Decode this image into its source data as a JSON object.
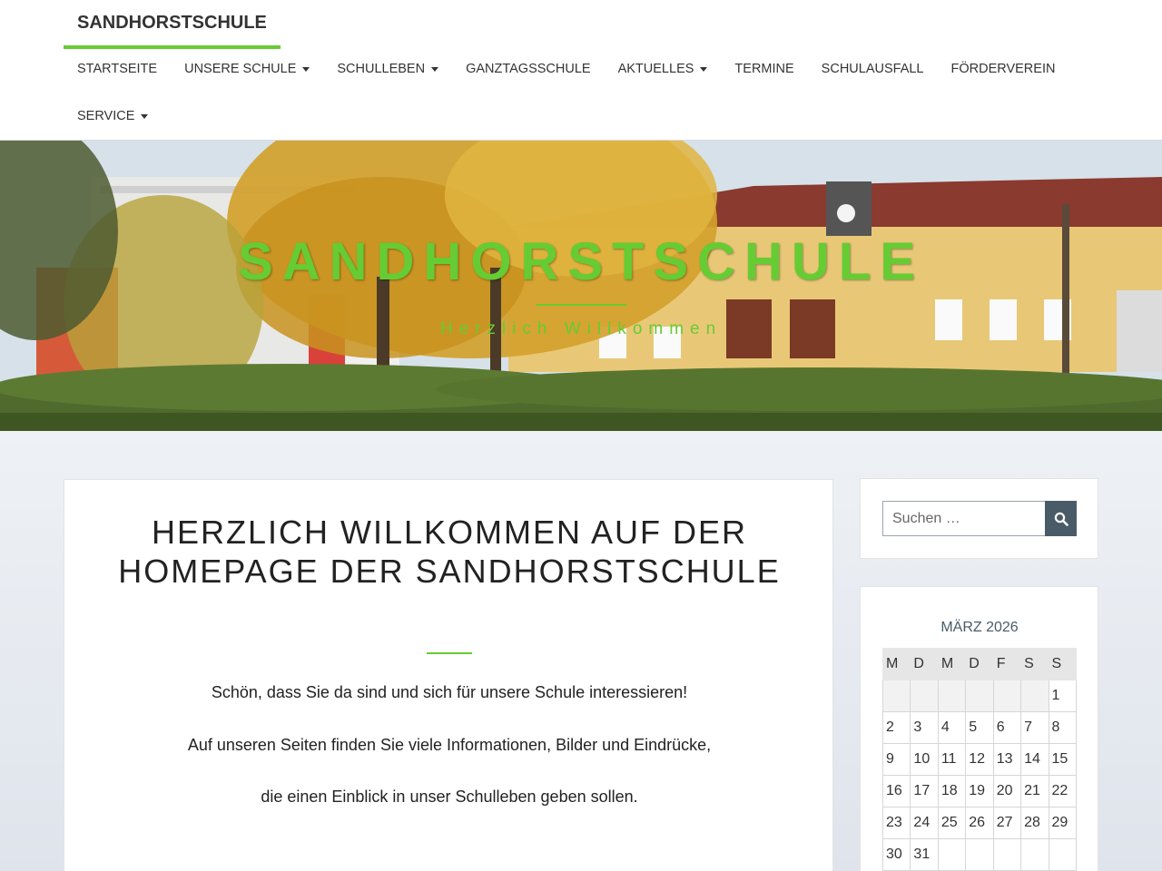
{
  "header": {
    "brand": "SANDHORSTSCHULE",
    "nav": [
      {
        "label": "STARTSEITE",
        "dropdown": false
      },
      {
        "label": "UNSERE SCHULE",
        "dropdown": true
      },
      {
        "label": "SCHULLEBEN",
        "dropdown": true
      },
      {
        "label": "GANZTAGSSCHULE",
        "dropdown": false
      },
      {
        "label": "AKTUELLES",
        "dropdown": true
      },
      {
        "label": "TERMINE",
        "dropdown": false
      },
      {
        "label": "SCHULAUSFALL",
        "dropdown": false
      },
      {
        "label": "FÖRDERVEREIN",
        "dropdown": false
      },
      {
        "label": "SERVICE",
        "dropdown": true
      }
    ]
  },
  "banner": {
    "title": "SANDHORSTSCHULE",
    "subtitle": "Herzlich Willkommen"
  },
  "main": {
    "title": "HERZLICH WILLKOMMEN AUF DER HOMEPAGE DER SANDHORSTSCHULE",
    "paragraphs": [
      "Schön, dass Sie da sind und sich für unsere Schule interessieren!",
      "Auf unseren Seiten finden Sie viele Informationen, Bilder und Eindrücke,",
      "die einen Einblick in unser Schulleben geben sollen."
    ]
  },
  "sidebar": {
    "search": {
      "placeholder": "Suchen …",
      "value": ""
    },
    "calendar": {
      "caption": "MÄRZ 2026",
      "weekdays": [
        "M",
        "D",
        "M",
        "D",
        "F",
        "S",
        "S"
      ],
      "weeks": [
        [
          "",
          "",
          "",
          "",
          "",
          "",
          "1"
        ],
        [
          "2",
          "3",
          "4",
          "5",
          "6",
          "7",
          "8"
        ],
        [
          "9",
          "10",
          "11",
          "12",
          "13",
          "14",
          "15"
        ],
        [
          "16",
          "17",
          "18",
          "19",
          "20",
          "21",
          "22"
        ],
        [
          "23",
          "24",
          "25",
          "26",
          "27",
          "28",
          "29"
        ],
        [
          "30",
          "31",
          "",
          "",
          "",
          "",
          ""
        ]
      ]
    }
  },
  "colors": {
    "accent": "#66cc33",
    "button": "#4a5b68"
  },
  "icons": {
    "search_button": "search-icon",
    "dropdown": "caret-down-icon"
  }
}
